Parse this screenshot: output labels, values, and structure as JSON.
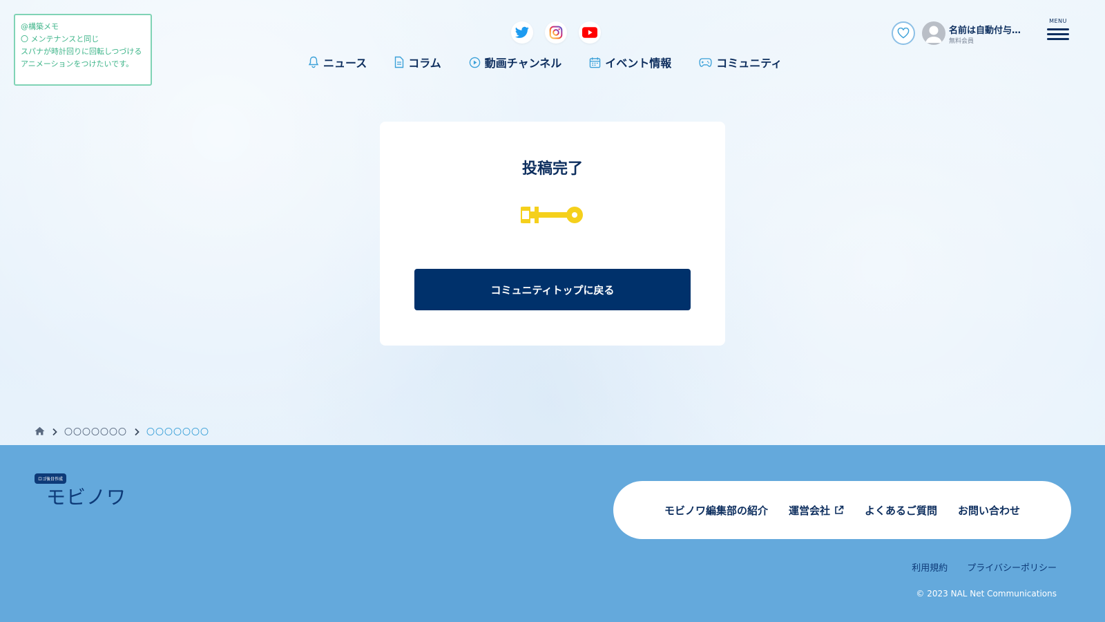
{
  "memo": {
    "line1": "@構築メモ",
    "line2": "〇 メンテナンスと同じ",
    "line3": "スパナが時計回りに回転しつづける",
    "line4": "アニメーションをつけたいです。"
  },
  "social": [
    {
      "icon": "twitter-icon",
      "color": "#1d9bf0"
    },
    {
      "icon": "instagram-icon",
      "color": "#d62976"
    },
    {
      "icon": "youtube-icon",
      "color": "#ff0000"
    }
  ],
  "nav": {
    "items": [
      {
        "label": "ニュース",
        "icon": "bell-icon"
      },
      {
        "label": "コラム",
        "icon": "document-icon"
      },
      {
        "label": "動画チャンネル",
        "icon": "play-icon"
      },
      {
        "label": "イベント情報",
        "icon": "calendar-icon"
      },
      {
        "label": "コミュニティ",
        "icon": "gamepad-icon"
      }
    ]
  },
  "user": {
    "name": "名前は自動付与…",
    "status": "無料会員"
  },
  "menu": {
    "label": "MENU"
  },
  "card": {
    "title": "投稿完了",
    "back_button": "コミュニティトップに戻る",
    "wrench_color": "#f5d01c"
  },
  "breadcrumb": {
    "item1": "〇〇〇〇〇〇〇",
    "item2": "〇〇〇〇〇〇〇"
  },
  "footer": {
    "logo_badge": "ロゴ後日作成",
    "logo_text": "モビノワ",
    "links": [
      "モビノワ編集部の紹介",
      "運営会社",
      "よくあるご質問",
      "お問い合わせ"
    ],
    "legal": [
      "利用規約",
      "プライバシーポリシー"
    ],
    "copyright": "© 2023 NAL Net Communications"
  },
  "colors": {
    "primary": "#00316b",
    "footer_bg": "#64a9dc",
    "accent": "#3aa0d8",
    "memo": "#3fb58a"
  }
}
